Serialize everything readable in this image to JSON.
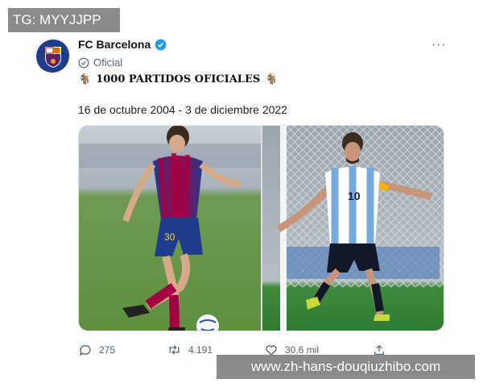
{
  "watermarks": {
    "top": "TG: MYYJJPP",
    "bottom": "www.zh-hans-douqiuzhibo.com"
  },
  "tweet": {
    "author_name": "FC Barcelona",
    "label": "Oficial",
    "headline": "1000 PARTIDOS OFICIALES",
    "emoji_left": "🐐",
    "emoji_right": "🐐",
    "date_range": "16 de octubre 2004 - 3 de diciembre 2022",
    "more": "···"
  },
  "photos": {
    "left": {
      "description_icon": "barcelona-player-photo"
    },
    "right": {
      "description_icon": "argentina-player-photo",
      "jersey_number": "10"
    },
    "left_jersey": "30"
  },
  "actions": {
    "replies": "275",
    "retweets": "4.191",
    "likes": "30,6 mil"
  },
  "colors": {
    "verified": "#1d9bf0",
    "barca_blue": "#1f3b8c",
    "barca_red": "#a50044"
  }
}
